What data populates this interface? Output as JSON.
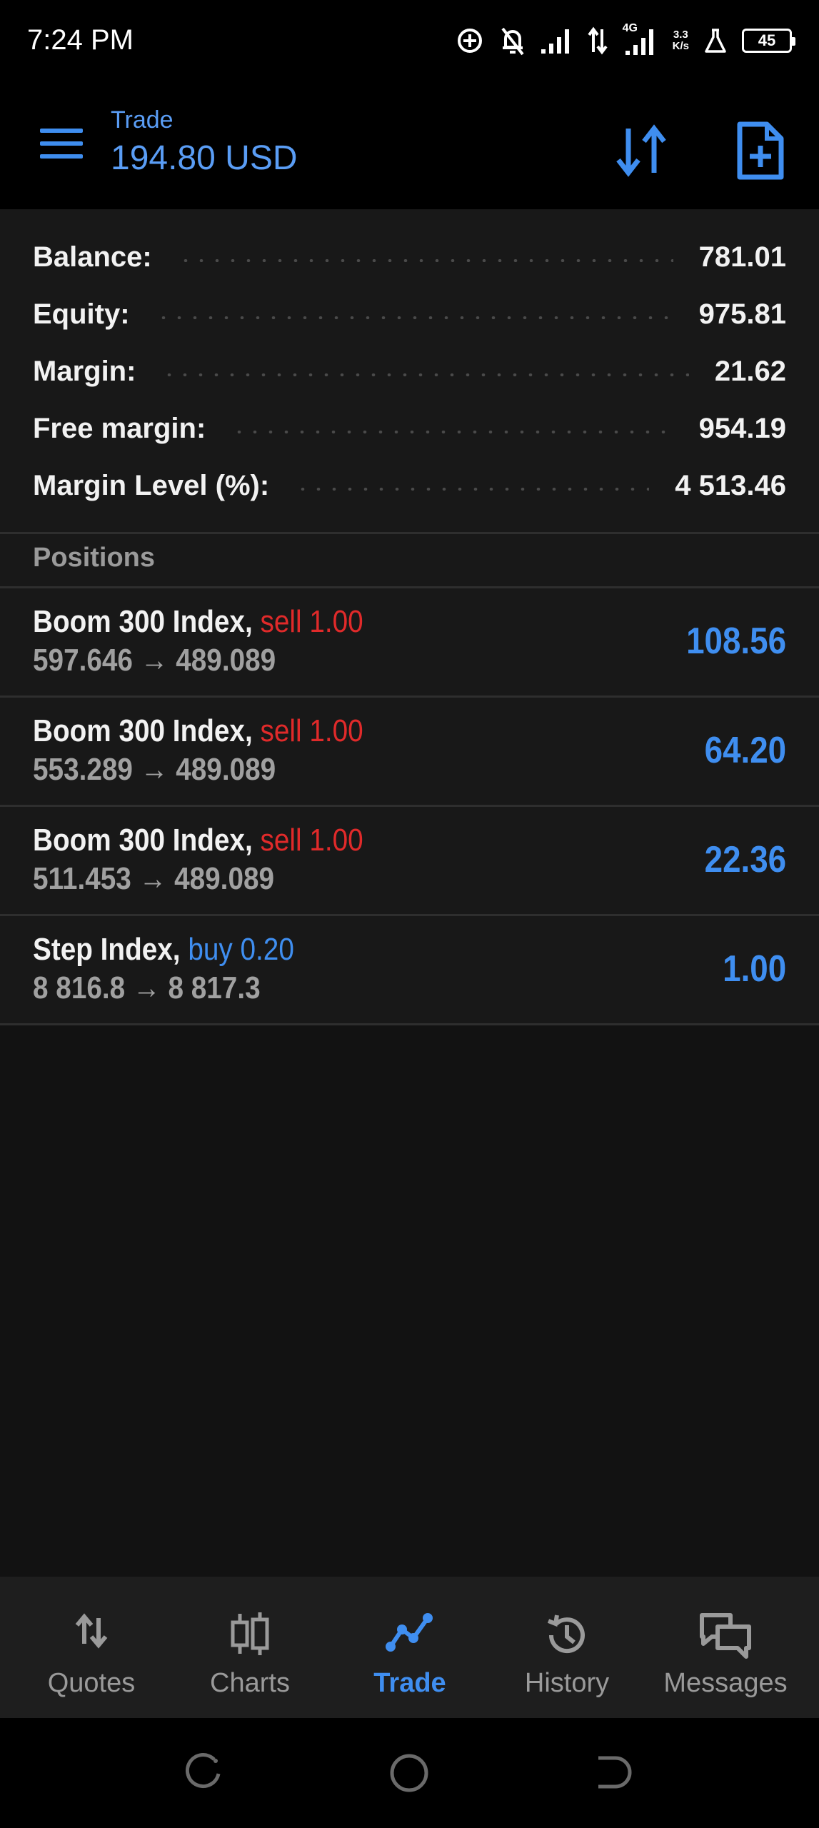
{
  "status_bar": {
    "time": "7:24 PM",
    "network_type": "4G",
    "speed_value": "3.3",
    "speed_unit": "K/s",
    "battery_level": "45"
  },
  "header": {
    "subtitle": "Trade",
    "title": "194.80 USD"
  },
  "summary": [
    {
      "label": "Balance:",
      "value": "781.01"
    },
    {
      "label": "Equity:",
      "value": "975.81"
    },
    {
      "label": "Margin:",
      "value": "21.62"
    },
    {
      "label": "Free margin:",
      "value": "954.19"
    },
    {
      "label": "Margin Level (%):",
      "value": "4 513.46"
    }
  ],
  "positions_title": "Positions",
  "positions": [
    {
      "symbol": "Boom 300 Index,",
      "side": "sell 1.00",
      "side_type": "sell",
      "open_price": "597.646",
      "arrow": "→",
      "current_price": "489.089",
      "profit": "108.56"
    },
    {
      "symbol": "Boom 300 Index,",
      "side": "sell 1.00",
      "side_type": "sell",
      "open_price": "553.289",
      "arrow": "→",
      "current_price": "489.089",
      "profit": "64.20"
    },
    {
      "symbol": "Boom 300 Index,",
      "side": "sell 1.00",
      "side_type": "sell",
      "open_price": "511.453",
      "arrow": "→",
      "current_price": "489.089",
      "profit": "22.36"
    },
    {
      "symbol": "Step Index,",
      "side": "buy 0.20",
      "side_type": "buy",
      "open_price": "8 816.8",
      "arrow": "→",
      "current_price": "8 817.3",
      "profit": "1.00"
    }
  ],
  "nav": [
    {
      "label": "Quotes",
      "icon": "quotes-arrows-icon",
      "active": false
    },
    {
      "label": "Charts",
      "icon": "candlestick-icon",
      "active": false
    },
    {
      "label": "Trade",
      "icon": "trade-line-icon",
      "active": true
    },
    {
      "label": "History",
      "icon": "history-clock-icon",
      "active": false
    },
    {
      "label": "Messages",
      "icon": "chat-bubbles-icon",
      "active": false
    }
  ],
  "colors": {
    "accent_blue": "#3f8ef0",
    "sell_red": "#e02a2a",
    "background": "#121212",
    "panel": "#181818"
  }
}
